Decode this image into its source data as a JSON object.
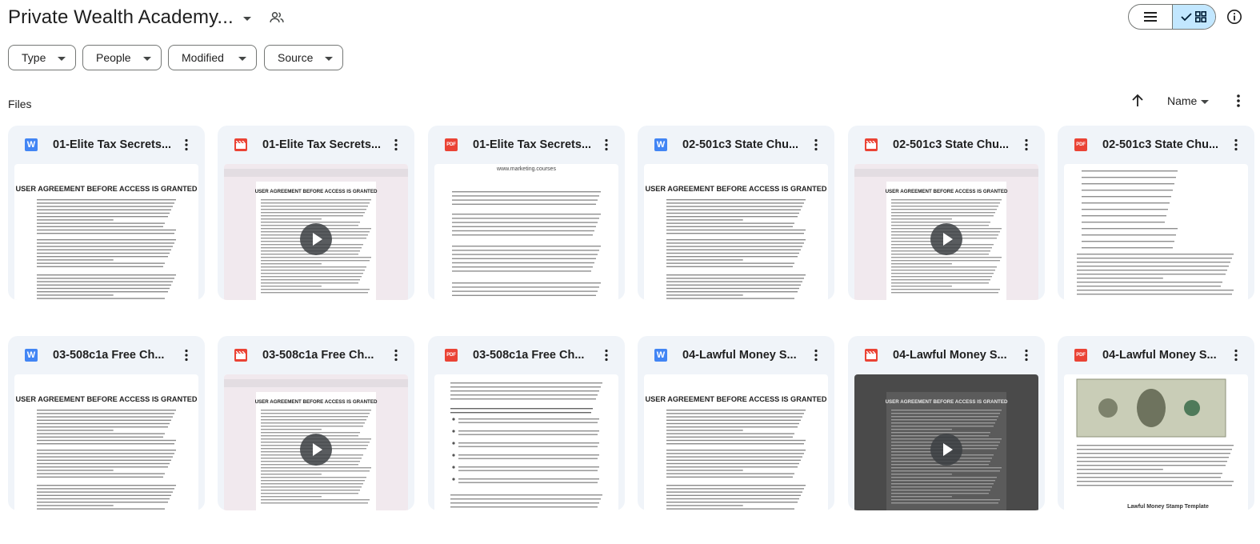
{
  "header": {
    "title": "Private Wealth Academy..."
  },
  "filters": [
    {
      "label": "Type"
    },
    {
      "label": "People"
    },
    {
      "label": "Modified"
    },
    {
      "label": "Source"
    }
  ],
  "section": {
    "label": "Files",
    "sort_label": "Name"
  },
  "files": [
    {
      "name": "01-Elite Tax Secrets...",
      "type": "doc",
      "thumb": "agreement"
    },
    {
      "name": "01-Elite Tax Secrets...",
      "type": "video",
      "thumb": "agreement-screen"
    },
    {
      "name": "01-Elite Tax Secrets...",
      "type": "pdf",
      "thumb": "course-text"
    },
    {
      "name": "02-501c3 State Chu...",
      "type": "doc",
      "thumb": "agreement"
    },
    {
      "name": "02-501c3 State Chu...",
      "type": "video",
      "thumb": "agreement-screen"
    },
    {
      "name": "02-501c3 State Chu...",
      "type": "pdf",
      "thumb": "list-text"
    },
    {
      "name": "03-508c1a Free Ch...",
      "type": "doc",
      "thumb": "agreement"
    },
    {
      "name": "03-508c1a Free Ch...",
      "type": "video",
      "thumb": "agreement-screen"
    },
    {
      "name": "03-508c1a Free Ch...",
      "type": "pdf",
      "thumb": "bullets-text"
    },
    {
      "name": "04-Lawful Money S...",
      "type": "doc",
      "thumb": "agreement"
    },
    {
      "name": "04-Lawful Money S...",
      "type": "video",
      "thumb": "agreement-dark"
    },
    {
      "name": "04-Lawful Money S...",
      "type": "pdf",
      "thumb": "dollar"
    }
  ],
  "thumb_text": {
    "agreement_heading": "USER AGREEMENT BEFORE ACCESS IS GRANTED",
    "site": "www.marketing.courses",
    "stamp_template": "Lawful Money Stamp Template"
  },
  "colors": {
    "doc": "#4285f4",
    "pdf": "#ea4335",
    "video": "#ea4335",
    "toggle_active": "#c2e7ff"
  }
}
